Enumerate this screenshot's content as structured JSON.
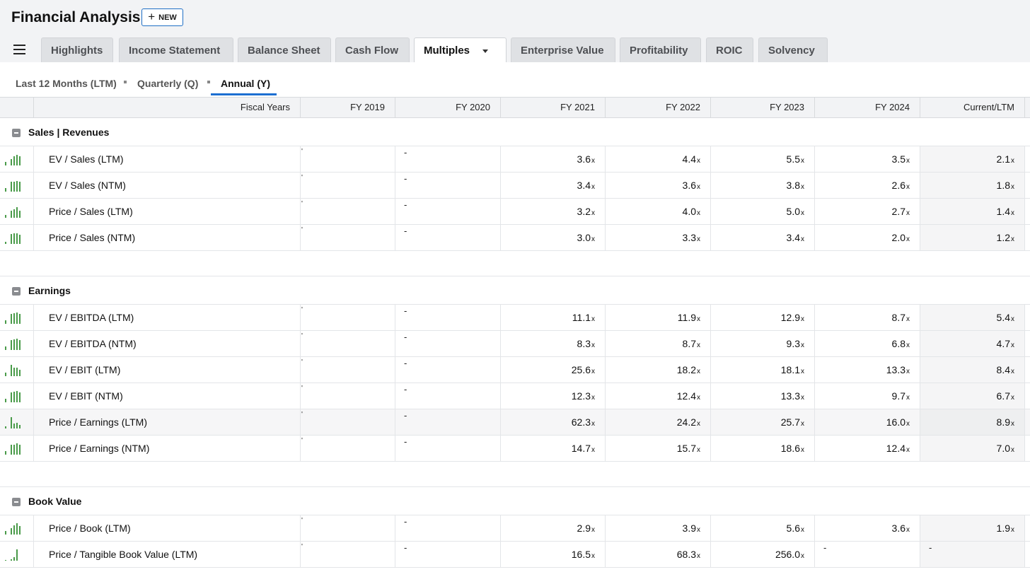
{
  "header": {
    "title": "Financial Analysis",
    "new_label": "NEW"
  },
  "tabs": [
    {
      "label": "Highlights"
    },
    {
      "label": "Income Statement"
    },
    {
      "label": "Balance Sheet"
    },
    {
      "label": "Cash Flow"
    },
    {
      "label": "Multiples"
    },
    {
      "label": "Enterprise Value"
    },
    {
      "label": "Profitability"
    },
    {
      "label": "ROIC"
    },
    {
      "label": "Solvency"
    }
  ],
  "active_tab": "Multiples",
  "periods": [
    {
      "label": "Last 12 Months (LTM)"
    },
    {
      "label": "Quarterly (Q)"
    },
    {
      "label": "Annual (Y)"
    }
  ],
  "active_period": "Annual (Y)",
  "columns": [
    "Fiscal Years",
    "FY 2019",
    "FY 2020",
    "FY 2021",
    "FY 2022",
    "FY 2023",
    "FY 2024",
    "Current/LTM"
  ],
  "multiple_suffix": "x",
  "empty_marks": {
    "tick": "'",
    "dash": "-"
  },
  "sections": [
    {
      "title": "Sales | Revenues",
      "rows": [
        {
          "name": "EV / Sales (LTM)",
          "values": [
            "3.6",
            "4.4",
            "5.5",
            "3.5",
            "2.1"
          ],
          "spark": [
            0.3,
            0.55,
            0.75,
            0.9,
            0.75
          ]
        },
        {
          "name": "EV / Sales (NTM)",
          "values": [
            "3.4",
            "3.6",
            "3.8",
            "2.6",
            "1.8"
          ],
          "spark": [
            0.3,
            0.8,
            0.85,
            0.9,
            0.8
          ]
        },
        {
          "name": "Price / Sales (LTM)",
          "values": [
            "3.2",
            "4.0",
            "5.0",
            "2.7",
            "1.4"
          ],
          "spark": [
            0.25,
            0.6,
            0.7,
            0.9,
            0.6
          ]
        },
        {
          "name": "Price / Sales (NTM)",
          "values": [
            "3.0",
            "3.3",
            "3.4",
            "2.0",
            "1.2"
          ],
          "spark": [
            0.2,
            0.85,
            0.9,
            0.9,
            0.75
          ]
        }
      ]
    },
    {
      "title": "Earnings",
      "rows": [
        {
          "name": "EV / EBITDA (LTM)",
          "values": [
            "11.1",
            "11.9",
            "12.9",
            "8.7",
            "5.4"
          ],
          "spark": [
            0.3,
            0.85,
            0.9,
            0.95,
            0.8
          ]
        },
        {
          "name": "EV / EBITDA (NTM)",
          "values": [
            "8.3",
            "8.7",
            "9.3",
            "6.8",
            "4.7"
          ],
          "spark": [
            0.3,
            0.85,
            0.9,
            0.95,
            0.85
          ]
        },
        {
          "name": "EV / EBIT (LTM)",
          "values": [
            "25.6",
            "18.2",
            "18.1",
            "13.3",
            "8.4"
          ],
          "spark": [
            0.3,
            0.95,
            0.7,
            0.7,
            0.55
          ]
        },
        {
          "name": "EV / EBIT (NTM)",
          "values": [
            "12.3",
            "12.4",
            "13.3",
            "9.7",
            "6.7"
          ],
          "spark": [
            0.3,
            0.85,
            0.9,
            0.95,
            0.8
          ]
        },
        {
          "name": "Price / Earnings (LTM)",
          "values": [
            "62.3",
            "24.2",
            "25.7",
            "16.0",
            "8.9"
          ],
          "spark": [
            0.15,
            0.95,
            0.4,
            0.45,
            0.3
          ],
          "highlight": true
        },
        {
          "name": "Price / Earnings (NTM)",
          "values": [
            "14.7",
            "15.7",
            "18.6",
            "12.4",
            "7.0"
          ],
          "spark": [
            0.3,
            0.8,
            0.85,
            0.95,
            0.8
          ]
        }
      ]
    },
    {
      "title": "Book Value",
      "rows": [
        {
          "name": "Price / Book (LTM)",
          "values": [
            "2.9",
            "3.9",
            "5.6",
            "3.6",
            "1.9"
          ],
          "spark": [
            0.3,
            0.55,
            0.75,
            0.95,
            0.7
          ]
        },
        {
          "name": "Price / Tangible Book Value (LTM)",
          "values": [
            "16.5",
            "68.3",
            "256.0",
            "",
            ""
          ],
          "spark": [
            0.08,
            0.12,
            0.3,
            0.95,
            0
          ]
        }
      ]
    }
  ]
}
